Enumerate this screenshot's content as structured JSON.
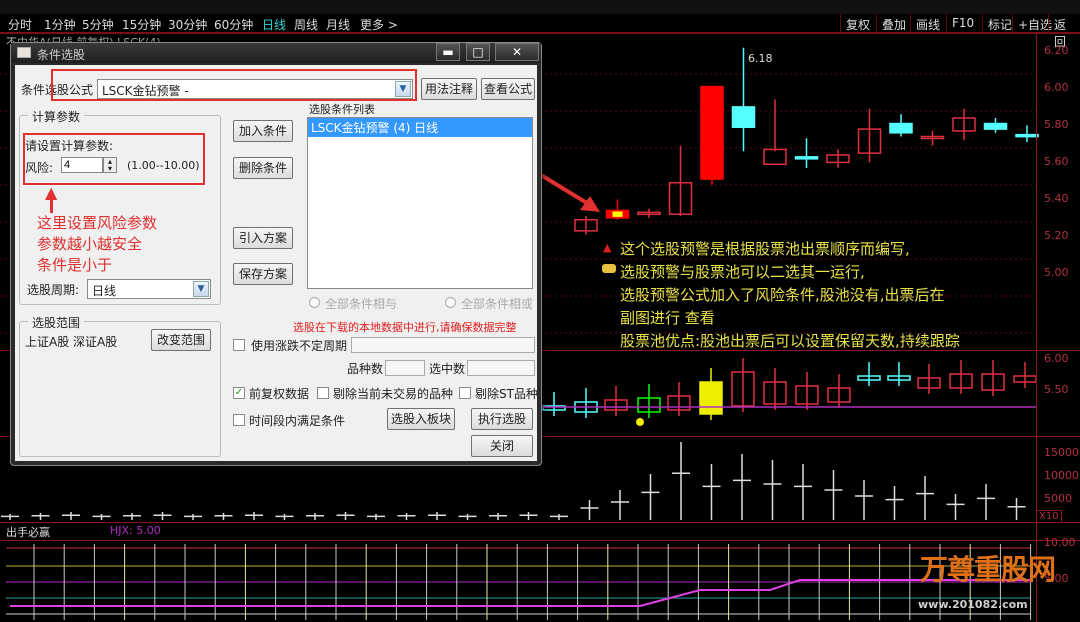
{
  "toolbar": {
    "periods": [
      "分时",
      "1分钟",
      "5分钟",
      "15分钟",
      "30分钟",
      "60分钟",
      "日线",
      "周线",
      "月线",
      "更多 >"
    ],
    "active_period": "日线",
    "right_buttons": [
      "复权",
      "叠加",
      "画线",
      "F10",
      "标记",
      "+自选",
      "返回"
    ]
  },
  "chart_header": "不中华A(日线 前复权) LSCK(4)",
  "dialog": {
    "title": "条件选股",
    "window_buttons": {
      "minimize": "▬",
      "maximize": "□",
      "close": "✕"
    },
    "formula_label": "条件选股公式",
    "formula_value": "LSCK金钻预警 -",
    "usage_button": "用法注释",
    "view_formula_button": "查看公式",
    "params_group_title": "计算参数",
    "params_prompt": "请设置计算参数:",
    "risk_label": "风险:",
    "risk_value": "4",
    "risk_range": "(1.00--10.00)",
    "annotation_lines": [
      "这里设置风险参数",
      "参数越小越安全",
      "条件是小于"
    ],
    "period_label": "选股周期:",
    "period_value": "日线",
    "add_condition": "加入条件",
    "delete_condition": "删除条件",
    "import_plan": "引入方案",
    "save_plan": "保存方案",
    "condition_list_title": "选股条件列表",
    "condition_list": [
      "LSCK金钻预警 (4) 日线"
    ],
    "radio_and": "全部条件相与",
    "radio_or": "全部条件相或",
    "warning": "选股在下载的本地数据中进行,请确保数据完整",
    "scope_group_title": "选股范围",
    "scope_value": "上证A股 深证A股",
    "change_scope": "改变范围",
    "use_variable_period": "使用涨跌不定周期",
    "variety_count_label": "品种数",
    "selected_count_label": "选中数",
    "forward_adjust": "前复权数据",
    "forward_adjust_checked": true,
    "exclude_untraded": "剔除当前未交易的品种",
    "exclude_st": "剔除ST品种",
    "period_satisfy": "时间段内满足条件",
    "to_block": "选股入板块",
    "execute": "执行选股",
    "close": "关闭"
  },
  "annotations": [
    "这个选股预警是根据股票池出票顺序而编写,",
    "选股预警与股票池可以二选其一运行,",
    "选股预警公式加入了风险条件,股池没有,出票后在",
    "副图进行 查看",
    "股票池优点:股池出票后可以设置保留天数,持续跟踪"
  ],
  "price_axis": [
    "6.20",
    "6.00",
    "5.80",
    "5.60",
    "5.40",
    "5.20",
    "5.00"
  ],
  "peak_label": "6.18",
  "sub_axis": [
    "6.00",
    "5.50"
  ],
  "volume_axis": [
    "15000",
    "10000",
    "5000"
  ],
  "volume_unit": "X10",
  "indicator": {
    "name": "出手必赢",
    "param": "HJX: 5.00"
  },
  "indicator_axis": [
    "10.00",
    "5.00"
  ],
  "watermark": {
    "name": "万尊重股网",
    "url": "www.201082.com"
  },
  "chart_data": {
    "type": "candlestick",
    "ylim": [
      4.9,
      6.25
    ],
    "peak": 6.18,
    "candles": [
      {
        "o": 5.19,
        "h": 5.27,
        "l": 5.17,
        "c": 5.25,
        "color": "red"
      },
      {
        "o": 5.26,
        "h": 5.36,
        "l": 5.25,
        "c": 5.3,
        "color": "signal"
      },
      {
        "o": 5.28,
        "h": 5.31,
        "l": 5.26,
        "c": 5.29,
        "color": "red"
      },
      {
        "o": 5.28,
        "h": 5.65,
        "l": 5.27,
        "c": 5.45,
        "color": "red"
      },
      {
        "o": 5.47,
        "h": 5.48,
        "l": 5.44,
        "c": 5.97,
        "color": "redfill"
      },
      {
        "o": 5.86,
        "h": 6.18,
        "l": 5.62,
        "c": 5.75,
        "color": "cyan"
      },
      {
        "o": 5.63,
        "h": 5.9,
        "l": 5.62,
        "c": 5.55,
        "color": "red"
      },
      {
        "o": 5.59,
        "h": 5.69,
        "l": 5.53,
        "c": 5.58,
        "color": "cyan"
      },
      {
        "o": 5.56,
        "h": 5.63,
        "l": 5.53,
        "c": 5.6,
        "color": "red"
      },
      {
        "o": 5.61,
        "h": 5.85,
        "l": 5.56,
        "c": 5.74,
        "color": "red"
      },
      {
        "o": 5.77,
        "h": 5.82,
        "l": 5.7,
        "c": 5.72,
        "color": "cyan"
      },
      {
        "o": 5.69,
        "h": 5.73,
        "l": 5.65,
        "c": 5.7,
        "color": "red"
      },
      {
        "o": 5.73,
        "h": 5.85,
        "l": 5.68,
        "c": 5.8,
        "color": "red"
      },
      {
        "o": 5.77,
        "h": 5.8,
        "l": 5.72,
        "c": 5.74,
        "color": "cyan"
      },
      {
        "o": 5.71,
        "h": 5.76,
        "l": 5.67,
        "c": 5.71,
        "color": "cyan"
      }
    ]
  }
}
